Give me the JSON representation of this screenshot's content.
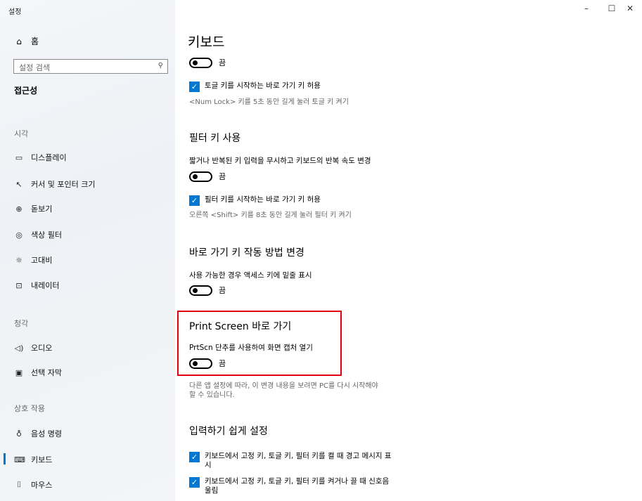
{
  "window": {
    "title": "설정",
    "min": "–",
    "max": "☐",
    "close": "✕"
  },
  "sidebar": {
    "home": {
      "icon": "home-icon",
      "label": "홈"
    },
    "search": {
      "placeholder": "설정 검색"
    },
    "category": "접근성",
    "groups": [
      {
        "label": "시각",
        "items": [
          {
            "icon": "display-icon",
            "label": "디스플레이"
          },
          {
            "icon": "cursor-icon",
            "label": "커서 및 포인터 크기"
          },
          {
            "icon": "magnifier-icon",
            "label": "돋보기"
          },
          {
            "icon": "color-filter-icon",
            "label": "색상 필터"
          },
          {
            "icon": "high-contrast-icon",
            "label": "고대비"
          },
          {
            "icon": "narrator-icon",
            "label": "내레이터"
          }
        ]
      },
      {
        "label": "청각",
        "items": [
          {
            "icon": "audio-icon",
            "label": "오디오"
          },
          {
            "icon": "captions-icon",
            "label": "선택 자막"
          }
        ]
      },
      {
        "label": "상호 작용",
        "items": [
          {
            "icon": "microphone-icon",
            "label": "음성 명령"
          },
          {
            "icon": "keyboard-icon",
            "label": "키보드"
          },
          {
            "icon": "mouse-icon",
            "label": "마우스"
          }
        ]
      }
    ],
    "selected": "키보드"
  },
  "main": {
    "title": "키보드",
    "top_toggle": {
      "state": "끔"
    },
    "toggle_keys_shortcut": {
      "checked": true,
      "label": "토글 키를 시작하는 바로 가기 키 허용",
      "desc": "<Num Lock> 키를 5초 동안 길게 눌러 토글 키 켜기"
    },
    "filter_keys": {
      "heading": "필터 키 사용",
      "desc": "짧거나 반복된 키 입력을 무시하고 키보드의 반복 속도 변경",
      "toggle_state": "끔",
      "shortcut_label": "필터 키를 시작하는 바로 가기 키 허용",
      "shortcut_desc": "오른쪽 <Shift> 키를 8초 동안 길게 눌러 필터 키 켜기"
    },
    "shortcut_behavior": {
      "heading": "바로 가기 키 작동 방법 변경",
      "desc": "사용 가능한 경우 액세스 키에 밑줄 표시",
      "toggle_state": "끔"
    },
    "print_screen": {
      "heading": "Print Screen 바로 가기",
      "desc": "PrtScn 단추를 사용하여 화면 캡처 열기",
      "toggle_state": "끔",
      "note_line1": "다른 앱 설정에 따라, 이 변경 내용을 보려면 PC를 다시 시작해야",
      "note_line2": "할 수 있습니다."
    },
    "easy_typing": {
      "heading": "입력하기 쉽게 설정",
      "check1_line1": "키보드에서 고정 키, 토글 키, 필터 키를 켤 때 경고 메시지 표",
      "check1_line2": "시",
      "check2_line1": "키보드에서 고정 키, 토글 키, 필터 키를 켜거나 끌 때 신호음",
      "check2_line2": "울림"
    }
  }
}
